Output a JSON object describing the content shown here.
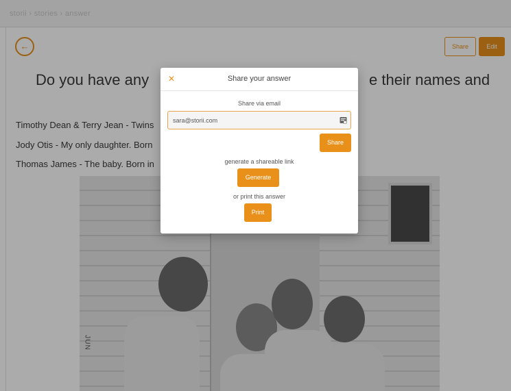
{
  "topbar": {
    "breadcrumb": "storii  ›  stories  ›  answer"
  },
  "page": {
    "share_label": "Share",
    "edit_label": "Edit",
    "question_visible_left": "Do you have any",
    "question_visible_right": "e their names and",
    "answers": [
      "Timothy Dean & Terry Jean - Twins",
      "Jody Otis - My only daughter. Born",
      "Thomas James - The baby. Born in"
    ],
    "photo_stamp": "JUN"
  },
  "modal": {
    "title": "Share your answer",
    "share_via_email_label": "Share via email",
    "email_value": "sara@storii.com",
    "share_button": "Share",
    "shareable_link_label": "generate a shareable link",
    "generate_button": "Generate",
    "print_label": "or print this answer",
    "print_button": "Print"
  },
  "colors": {
    "accent": "#e8901a"
  },
  "icons": {
    "back": "arrow-left-icon",
    "close": "close-icon",
    "contacts": "contact-card-icon"
  }
}
